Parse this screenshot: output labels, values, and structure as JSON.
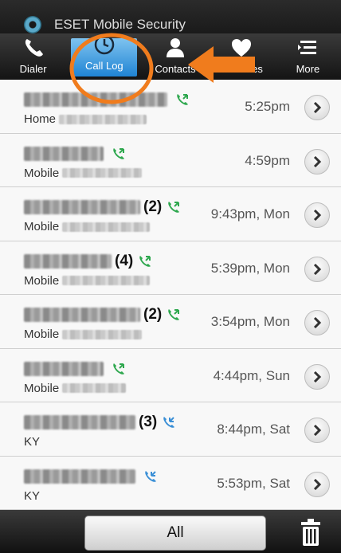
{
  "app": {
    "title": "ESET Mobile Security"
  },
  "tabs": [
    {
      "label": "Dialer",
      "icon": "phone-icon",
      "selected": false
    },
    {
      "label": "Call Log",
      "icon": "clock-icon",
      "selected": true
    },
    {
      "label": "Contacts",
      "icon": "person-icon",
      "selected": false
    },
    {
      "label": "Favorites",
      "icon": "heart-icon",
      "selected": false
    },
    {
      "label": "More",
      "icon": "menu-list-icon",
      "selected": false
    }
  ],
  "calls": [
    {
      "count": "",
      "call_type": "incoming",
      "number_type": "Home",
      "time": "5:25pm"
    },
    {
      "count": "",
      "call_type": "incoming",
      "number_type": "Mobile",
      "time": "4:59pm"
    },
    {
      "count": "(2)",
      "call_type": "incoming",
      "number_type": "Mobile",
      "time": "9:43pm, Mon"
    },
    {
      "count": "(4)",
      "call_type": "incoming",
      "number_type": "Mobile",
      "time": "5:39pm, Mon"
    },
    {
      "count": "(2)",
      "call_type": "incoming",
      "number_type": "Mobile",
      "time": "3:54pm, Mon"
    },
    {
      "count": "",
      "call_type": "incoming",
      "number_type": "Mobile",
      "time": "4:44pm, Sun"
    },
    {
      "count": "(3)",
      "call_type": "outgoing",
      "number_type": "KY",
      "time": "8:44pm, Sat"
    },
    {
      "count": "",
      "call_type": "outgoing",
      "number_type": "KY",
      "time": "5:53pm, Sat"
    }
  ],
  "bottom": {
    "filter_label": "All"
  },
  "colors": {
    "incoming": "#2fa84f",
    "outgoing": "#3a8fd6",
    "annotation": "#f07c1d",
    "selected_tab": "#3d9ae2"
  }
}
